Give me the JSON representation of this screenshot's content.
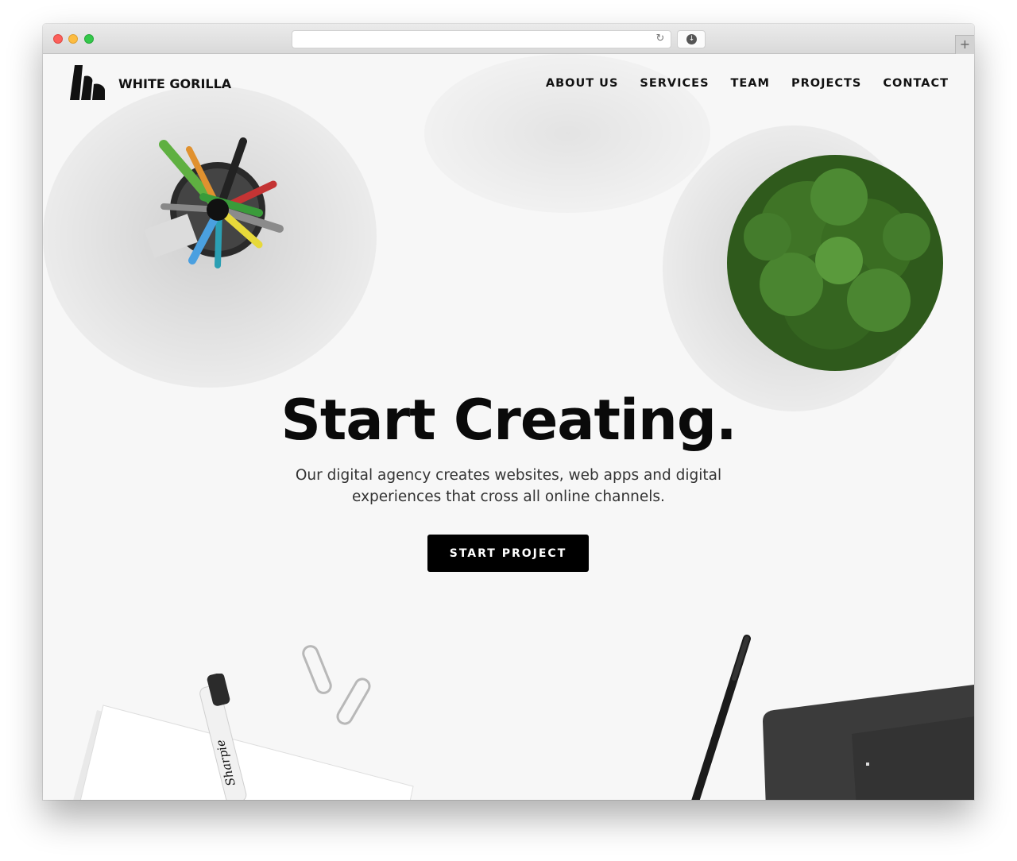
{
  "browser": {
    "url": "",
    "controls": [
      "close",
      "minimize",
      "zoom"
    ]
  },
  "brand": {
    "name": "WHITE GORILLA"
  },
  "nav": {
    "items": [
      "ABOUT US",
      "SERVICES",
      "TEAM",
      "PROJECTS",
      "CONTACT"
    ]
  },
  "hero": {
    "title": "Start Creating.",
    "subtitle": "Our digital agency creates websites, web apps and digital experiences that cross all online channels.",
    "cta_label": "START PROJECT"
  },
  "decor": {
    "items": [
      "pen-holder",
      "potted-plant",
      "paper-stack",
      "marker",
      "paperclips",
      "stylus-pen",
      "drawing-tablet"
    ],
    "marker_label": "Sharpie"
  },
  "colors": {
    "background": "#f7f7f7",
    "text": "#111111",
    "cta_background": "#000000",
    "cta_text": "#ffffff"
  }
}
